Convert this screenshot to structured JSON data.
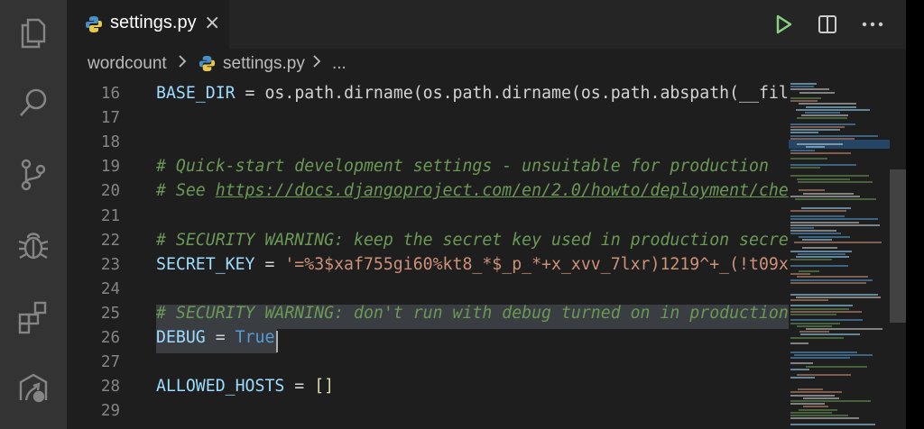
{
  "tab": {
    "label": "settings.py",
    "close_symbol": "×"
  },
  "breadcrumb": {
    "folder": "wordcount",
    "file": "settings.py",
    "more": "..."
  },
  "activity": [
    "explorer-icon",
    "search-icon",
    "source-control-icon",
    "debug-icon",
    "extensions-icon",
    "remote-icon"
  ],
  "editor": {
    "lines": [
      {
        "num": "16",
        "segments": [
          [
            "v",
            "BASE_DIR"
          ],
          [
            "p",
            " = "
          ],
          [
            "p",
            "os.path.dirname(os.path.dirname(os.path.abspath(__fil"
          ]
        ]
      },
      {
        "num": "17",
        "segments": []
      },
      {
        "num": "18",
        "segments": []
      },
      {
        "num": "19",
        "segments": [
          [
            "com",
            "# Quick-start development settings - unsuitable for production"
          ]
        ]
      },
      {
        "num": "20",
        "segments": [
          [
            "com",
            "# See "
          ],
          [
            "link",
            "https://docs.djangoproject.com/en/2.0/howto/deployment/che"
          ]
        ]
      },
      {
        "num": "21",
        "segments": []
      },
      {
        "num": "22",
        "segments": [
          [
            "com",
            "# SECURITY WARNING: keep the secret key used in production secre"
          ]
        ]
      },
      {
        "num": "23",
        "segments": [
          [
            "v",
            "SECRET_KEY"
          ],
          [
            "p",
            " = "
          ],
          [
            "str",
            "'=%3$xaf755gi60%kt8_*$_p_*+x_xvv_7lxr)1219^+_(!t09x"
          ]
        ]
      },
      {
        "num": "24",
        "segments": []
      },
      {
        "num": "25",
        "segments": [
          [
            "com",
            "# SECURITY WARNING: don't run with debug turned on in production"
          ]
        ]
      },
      {
        "num": "26",
        "segments": [
          [
            "v",
            "DEBUG"
          ],
          [
            "p",
            " = "
          ],
          [
            "kw",
            "True"
          ]
        ]
      },
      {
        "num": "27",
        "segments": []
      },
      {
        "num": "28",
        "segments": [
          [
            "v",
            "ALLOWED_HOSTS"
          ],
          [
            "p",
            " = "
          ],
          [
            "yel",
            "[]"
          ]
        ]
      },
      {
        "num": "29",
        "segments": []
      }
    ]
  },
  "colors": {
    "background": "#1e1e1e",
    "activity_bar": "#333333",
    "variable": "#9cdcfe",
    "comment": "#6a9955",
    "string": "#ce9178",
    "keyword": "#569cd6",
    "run_icon": "#89d185"
  }
}
